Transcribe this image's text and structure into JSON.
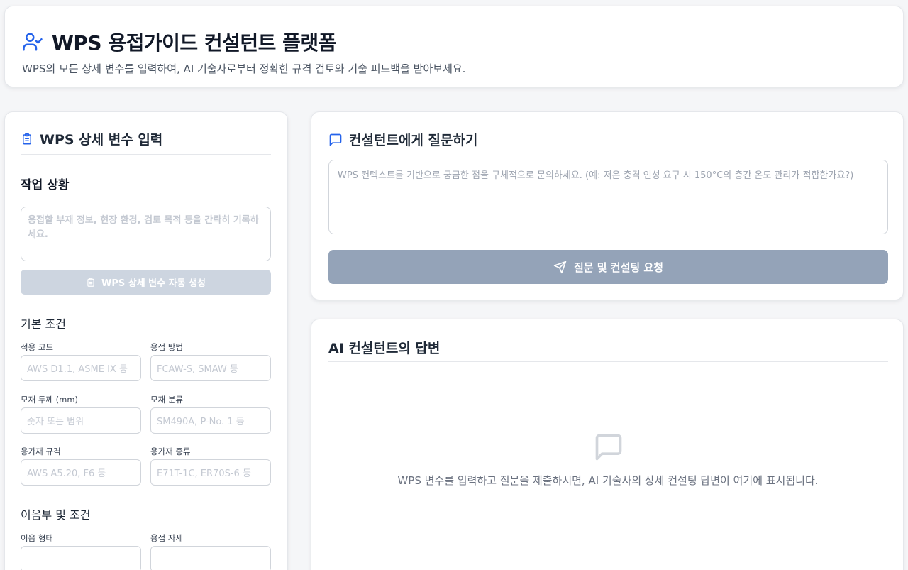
{
  "header": {
    "title": "WPS 용접가이드 컨설턴트 플랫폼",
    "subtitle": "WPS의 모든 상세 변수를 입력하여, AI 기술사로부터 정확한 규격 검토와 기술 피드백을 받아보세요.",
    "icon": "user-check-icon"
  },
  "left": {
    "title": "WPS 상세 변수 입력",
    "icon": "clipboard-icon",
    "work": {
      "title": "작업 상황",
      "placeholder": "용접할 부재 정보, 현장 환경, 검토 목적 등을 간략히 기록하세요."
    },
    "generate_button": "WPS 상세 변수 자동 생성",
    "basic": {
      "title": "기본 조건",
      "fields": [
        {
          "label": "적용 코드",
          "placeholder": "AWS D1.1, ASME IX 등"
        },
        {
          "label": "용접 방법",
          "placeholder": "FCAW-S, SMAW 등"
        },
        {
          "label": "모재 두께 (mm)",
          "placeholder": "숫자 또는 범위"
        },
        {
          "label": "모재 분류",
          "placeholder": "SM490A, P-No. 1 등"
        },
        {
          "label": "용가재 규격",
          "placeholder": "AWS A5.20, F6 등"
        },
        {
          "label": "용가재 종류",
          "placeholder": "E71T-1C, ER70S-6 등"
        }
      ]
    },
    "joint": {
      "title": "이음부 및 조건",
      "fields": [
        {
          "label": "이음 형태"
        },
        {
          "label": "용접 자세"
        }
      ]
    }
  },
  "ask": {
    "title": "컨설턴트에게 질문하기",
    "icon": "message-square-icon",
    "placeholder": "WPS 컨텍스트를 기반으로 궁금한 점을 구체적으로 문의하세요. (예: 저온 충격 인성 요구 시 150°C의 층간 온도 관리가 적합한가요?)",
    "button": "질문 및 컨설팅 요청",
    "button_icon": "send-icon"
  },
  "answer": {
    "title": "AI 컨설턴트의 답변",
    "empty_icon": "message-square-icon",
    "empty_text": "WPS 변수를 입력하고 질문을 제출하시면, AI 기술사의 상세 컨설팅 답변이 여기에 표시됩니다."
  },
  "colors": {
    "accent": "#2563eb",
    "disabled_button": "#94a3b8",
    "disabled_light": "#cdd5e0"
  }
}
